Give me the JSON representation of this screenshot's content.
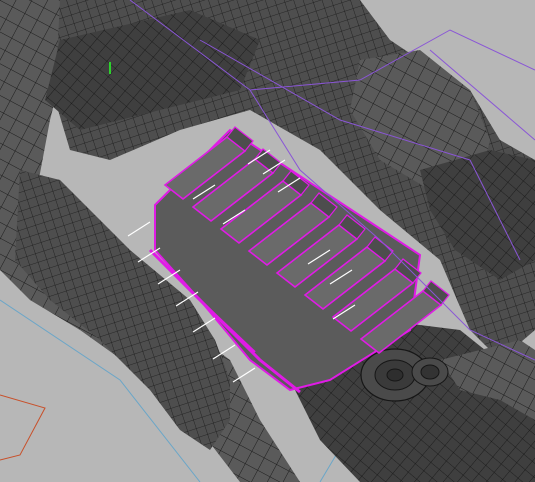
{
  "viewport": {
    "background": "#b7b7b7",
    "mesh_fill": "#5a5a5a",
    "mesh_dark": "#3f3f3f",
    "wire_color": "#1a1a1a",
    "selection_color": "#e01be6",
    "selected_face_fill": "#6a6a6a",
    "normal_color": "#ffffff",
    "helper_color": "#8a56d6",
    "axis_blue": "#6aa6c8",
    "axis_red": "#c8502a",
    "axis_green": "#2dd12d",
    "selected_face_count": 8
  }
}
